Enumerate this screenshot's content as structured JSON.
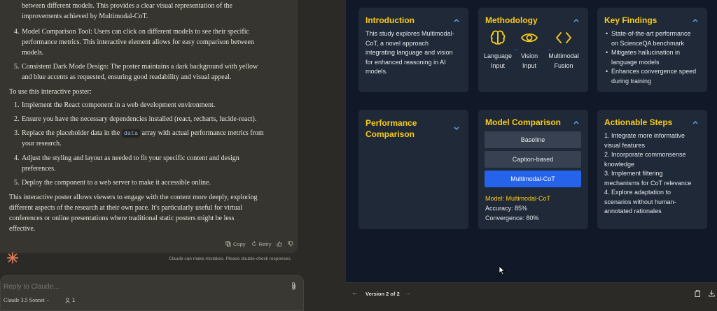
{
  "chat": {
    "intro_lines": [
      "between different models. This provides a clear visual representation of the",
      "improvements achieved by Multimodal-CoT."
    ],
    "feature_items": [
      {
        "num": "4.",
        "lines": [
          "Model Comparison Tool: Users can click on different models to see their specific",
          "performance metrics. This interactive element allows for easy comparison between",
          "models."
        ]
      },
      {
        "num": "5.",
        "lines": [
          "Consistent Dark Mode Design: The poster maintains a dark background with yellow",
          "and blue accents as requested, ensuring good readability and visual appeal."
        ]
      }
    ],
    "usage_heading": "To use this interactive poster:",
    "steps": [
      {
        "num": "1.",
        "lines": [
          "Implement the React component in a web development environment."
        ]
      },
      {
        "num": "2.",
        "lines": [
          "Ensure you have the necessary dependencies installed (react, recharts, lucide-react)."
        ]
      },
      {
        "num": "3.",
        "line1_before": "Replace the placeholder data in the ",
        "line1_code": "data",
        "line1_after": " array with actual performance metrics from",
        "line2": "your research."
      },
      {
        "num": "4.",
        "lines": [
          "Adjust the styling and layout as needed to fit your specific content and design",
          "preferences."
        ]
      },
      {
        "num": "5.",
        "lines": [
          "Deploy the component to a web server to make it accessible online."
        ]
      }
    ],
    "closing_lines": [
      "This interactive poster allows viewers to engage with the content more deeply, exploring",
      "different aspects of the research at their own pace. It's particularly useful for virtual",
      "conferences or online presentations where traditional static posters might be less",
      "effective."
    ],
    "actions": {
      "copy": "Copy",
      "retry": "Retry"
    },
    "disclaimer": "Claude can make mistakes. Please double-check responses.",
    "composer_placeholder": "Reply to Claude...",
    "model_name": "Claude 3.5 Sonnet",
    "user_count": "1"
  },
  "artifact": {
    "introduction": {
      "title": "Introduction",
      "text_lines": [
        "This study explores Multimodal-",
        "CoT, a novel approach",
        "integrating language and vision",
        "for enhanced reasoning in AI",
        "models."
      ]
    },
    "methodology": {
      "title": "Methodology",
      "steps": [
        {
          "icon": "brain-icon",
          "lines": [
            "Language",
            "Input"
          ]
        },
        {
          "icon": "eye-icon",
          "lines": [
            "Vision",
            "Input"
          ]
        },
        {
          "icon": "code-icon",
          "lines": [
            "Multimodal",
            "Fusion"
          ]
        }
      ],
      "arrow": "→"
    },
    "key_findings": {
      "title": "Key Findings",
      "items": [
        [
          "State-of-the-art performance",
          "on ScienceQA benchmark"
        ],
        [
          "Mitigates hallucination in",
          "language models"
        ],
        [
          "Enhances convergence speed",
          "during training"
        ]
      ]
    },
    "performance": {
      "title_lines": [
        "Performance",
        "Comparison"
      ]
    },
    "model_comparison": {
      "title": "Model Comparison",
      "buttons": [
        "Baseline",
        "Caption-based",
        "Multimodal-CoT"
      ],
      "selected_model_line": "Model: Multimodal-CoT",
      "accuracy_line": "Accuracy: 85%",
      "convergence_line": "Convergence: 80%"
    },
    "actionable_steps": {
      "title": "Actionable Steps",
      "lines": [
        "1. Integrate more informative",
        "visual features",
        "2. Incorporate commonsense",
        "knowledge",
        "3. Implement filtering",
        "mechanisms for CoT relevance",
        "4. Explore adaptation to",
        "scenarios without human-",
        "annotated rationales"
      ]
    },
    "footer": {
      "version_label": "Version 2 of 2",
      "prev": "←",
      "next": "→"
    }
  },
  "colors": {
    "accent_yellow": "#facc15",
    "accent_blue": "#2563eb",
    "card_bg": "#1f2937",
    "artifact_bg": "#111827",
    "chat_bg": "#2b2a27"
  }
}
